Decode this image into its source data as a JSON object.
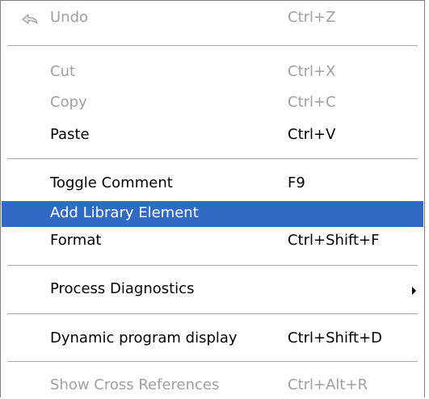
{
  "menu": {
    "items": [
      {
        "label": "Undo",
        "shortcut": "Ctrl+Z",
        "enabled": false,
        "icon": "undo-icon"
      },
      {
        "label": "Cut",
        "shortcut": "Ctrl+X",
        "enabled": false
      },
      {
        "label": "Copy",
        "shortcut": "Ctrl+C",
        "enabled": false
      },
      {
        "label": "Paste",
        "shortcut": "Ctrl+V",
        "enabled": true
      },
      {
        "label": "Toggle Comment",
        "shortcut": "F9",
        "enabled": true
      },
      {
        "label": "Add Library Element",
        "shortcut": "",
        "enabled": true,
        "highlighted": true
      },
      {
        "label": "Format",
        "shortcut": "Ctrl+Shift+F",
        "enabled": true
      },
      {
        "label": "Process Diagnostics",
        "shortcut": "",
        "enabled": true,
        "submenu": true,
        "icon": "submenu-arrow-icon"
      },
      {
        "label": "Dynamic program display",
        "shortcut": "Ctrl+Shift+D",
        "enabled": true
      },
      {
        "label": "Show Cross References",
        "shortcut": "Ctrl+Alt+R",
        "enabled": false
      }
    ]
  },
  "colors": {
    "highlight": "#316ac5",
    "highlight_text": "#ffffff",
    "disabled_text": "#a0a0a0",
    "text": "#000000"
  }
}
